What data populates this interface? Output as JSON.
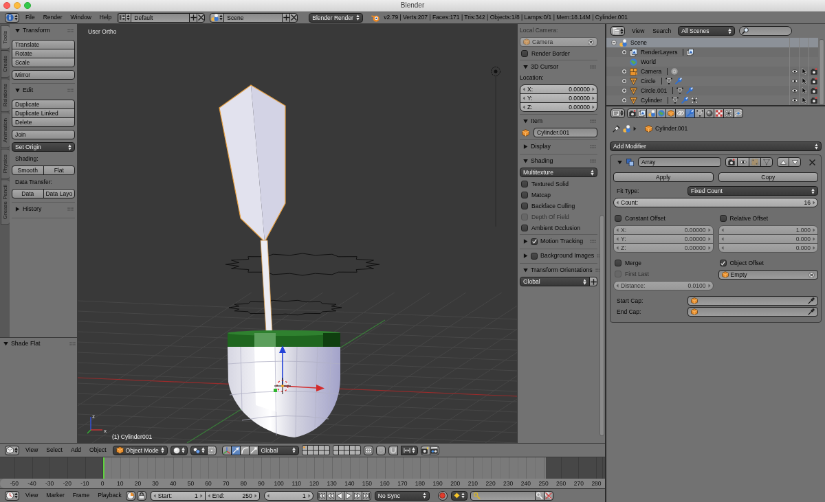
{
  "window": {
    "title": "Blender"
  },
  "info_header": {
    "menus": [
      "File",
      "Render",
      "Window",
      "Help"
    ],
    "layout": "Default",
    "scene": "Scene",
    "engine": "Blender Render",
    "stats": "v2.79 | Verts:207 | Faces:171 | Tris:342 | Objects:1/8 | Lamps:0/1 | Mem:18.14M | Cylinder.001"
  },
  "tool_tabs": [
    {
      "label": "Tools",
      "selected": true
    },
    {
      "label": "Create",
      "selected": false
    },
    {
      "label": "Relations",
      "selected": false
    },
    {
      "label": "Animation",
      "selected": false
    },
    {
      "label": "Physics",
      "selected": false
    },
    {
      "label": "Grease Pencil",
      "selected": false
    }
  ],
  "tool_panels": [
    {
      "title": "Transform",
      "expanded": true,
      "rows": [
        {
          "kind": "column",
          "buttons": [
            "Translate",
            "Rotate",
            "Scale"
          ]
        },
        {
          "kind": "column",
          "buttons": [
            "Mirror"
          ]
        }
      ]
    },
    {
      "title": "Edit",
      "expanded": true,
      "rows": [
        {
          "kind": "column",
          "buttons": [
            "Duplicate",
            "Duplicate Linked",
            "Delete"
          ]
        },
        {
          "kind": "column",
          "buttons": [
            "Join"
          ]
        },
        {
          "kind": "menu",
          "text": "Set Origin"
        },
        {
          "kind": "label",
          "text": "Shading:"
        },
        {
          "kind": "row",
          "buttons": [
            "Smooth",
            "Flat"
          ]
        },
        {
          "kind": "label",
          "text": "Data Transfer:"
        },
        {
          "kind": "row",
          "buttons": [
            "Data",
            "Data Layo"
          ]
        }
      ]
    },
    {
      "title": "History",
      "expanded": false
    }
  ],
  "operator_panel": {
    "title": "Shade Flat",
    "expanded": true
  },
  "viewport": {
    "view_label": "User Ortho",
    "object_label": "(1) Cylinder001",
    "axis_labels": [
      "z",
      "x"
    ]
  },
  "sidebar": [
    {
      "rows": [
        {
          "kind": "label",
          "text": "Local Camera:",
          "disabled": true
        },
        {
          "kind": "object_field",
          "text": "Camera",
          "disabled": true
        },
        {
          "kind": "checkbox",
          "label": "Render Border",
          "checked": false,
          "disabled": false
        }
      ]
    },
    {
      "title": "3D Cursor",
      "expanded": true,
      "rows": [
        {
          "kind": "label",
          "text": "Location:",
          "disabled": false
        },
        {
          "kind": "vector",
          "fields": [
            {
              "label": "X:",
              "value": "0.00000"
            },
            {
              "label": "Y:",
              "value": "0.00000"
            },
            {
              "label": "Z:",
              "value": "0.00000"
            }
          ]
        }
      ]
    },
    {
      "title": "Item",
      "expanded": true,
      "rows": [
        {
          "kind": "name_field",
          "text": "Cylinder.001"
        }
      ]
    },
    {
      "title": "Display",
      "expanded": false
    },
    {
      "title": "Shading",
      "expanded": true,
      "rows": [
        {
          "kind": "dropdown",
          "text": "Multitexture"
        },
        {
          "kind": "checkbox",
          "label": "Textured Solid",
          "checked": false,
          "disabled": false
        },
        {
          "kind": "checkbox",
          "label": "Matcap",
          "checked": false,
          "disabled": false
        },
        {
          "kind": "checkbox",
          "label": "Backface Culling",
          "checked": false,
          "disabled": false
        },
        {
          "kind": "checkbox",
          "label": "Depth Of Field",
          "checked": false,
          "disabled": true
        },
        {
          "kind": "checkbox",
          "label": "Ambient Occlusion",
          "checked": false,
          "disabled": false
        }
      ]
    },
    {
      "title": "Motion Tracking",
      "expanded": false,
      "checked": true
    },
    {
      "title": "Background Images",
      "expanded": false,
      "checked": false
    },
    {
      "title": "Transform Orientations",
      "expanded": true,
      "rows": [
        {
          "kind": "orientation",
          "text": "Global"
        }
      ]
    }
  ],
  "outliner": {
    "menus": [
      "View",
      "Search"
    ],
    "filter": "All Scenes",
    "tree": [
      {
        "label": "Scene",
        "kind": "scene",
        "expanded": true,
        "selected": true,
        "children": [
          {
            "label": "RenderLayers",
            "kind": "render_layers",
            "expanded": false,
            "selected": false,
            "data_icons": [
              {
                "kind": "render_layers"
              }
            ]
          },
          {
            "label": "World",
            "kind": "world",
            "selected": false
          },
          {
            "label": "Camera",
            "kind": "camera",
            "expanded": false,
            "selected": false,
            "data_icons": [
              {
                "kind": "camera_data"
              }
            ]
          },
          {
            "label": "Circle",
            "kind": "mesh",
            "expanded": false,
            "selected": false,
            "data_icons": [
              {
                "kind": "mesh_data"
              },
              {
                "kind": "modifier"
              }
            ]
          },
          {
            "label": "Circle.001",
            "kind": "mesh",
            "expanded": false,
            "selected": false,
            "data_icons": [
              {
                "kind": "mesh_data"
              },
              {
                "kind": "modifier"
              }
            ]
          },
          {
            "label": "Cylinder",
            "kind": "mesh",
            "expanded": false,
            "selected": false,
            "data_icons": [
              {
                "kind": "mesh_data"
              },
              {
                "kind": "modifier"
              },
              {
                "kind": "particles"
              }
            ]
          }
        ]
      }
    ]
  },
  "properties": {
    "tabs": [
      {
        "kind": "render",
        "selected": false
      },
      {
        "kind": "render_layers",
        "selected": false
      },
      {
        "kind": "scene",
        "selected": false
      },
      {
        "kind": "world",
        "selected": false
      },
      {
        "kind": "object",
        "selected": false
      },
      {
        "kind": "constraints",
        "selected": false
      },
      {
        "kind": "modifiers",
        "selected": true
      },
      {
        "kind": "data",
        "selected": false
      },
      {
        "kind": "material",
        "selected": false
      },
      {
        "kind": "texture",
        "selected": false
      },
      {
        "kind": "particles",
        "selected": false
      },
      {
        "kind": "physics",
        "selected": false
      }
    ],
    "context": "Cylinder.001",
    "add_modifier": "Add Modifier",
    "modifier": {
      "name": "Array",
      "expanded": true,
      "toggles": [
        {
          "kind": "render",
          "on": true
        },
        {
          "kind": "viewport",
          "on": true
        },
        {
          "kind": "editmode",
          "on": false
        },
        {
          "kind": "cage",
          "on": false
        }
      ],
      "apply": "Apply",
      "copy": "Copy",
      "fit_type_label": "Fit Type:",
      "fit_type": "Fixed Count",
      "count_label": "Count:",
      "count": "16",
      "constant_offset": {
        "label": "Constant Offset",
        "checked": false,
        "fields": [
          {
            "label": "X:",
            "value": "0.00000"
          },
          {
            "label": "Y:",
            "value": "0.00000"
          },
          {
            "label": "Z:",
            "value": "0.00000"
          }
        ]
      },
      "relative_offset": {
        "label": "Relative Offset",
        "checked": false,
        "fields": [
          {
            "value": "1.000"
          },
          {
            "value": "0.000"
          },
          {
            "value": "0.000"
          }
        ]
      },
      "merge": {
        "label": "Merge",
        "checked": false
      },
      "first_last": {
        "label": "First Last",
        "checked": false
      },
      "distance_label": "Distance:",
      "distance": "0.0100",
      "object_offset": {
        "label": "Object Offset",
        "checked": true,
        "object": "Empty"
      },
      "caps": [
        {
          "label": "Start Cap:"
        },
        {
          "label": "End Cap:"
        }
      ]
    }
  },
  "view3d_header": {
    "menus": [
      "View",
      "Select",
      "Add",
      "Object"
    ],
    "mode": "Object Mode",
    "manipulators": [
      {
        "kind": "axes",
        "selected": false
      },
      {
        "kind": "translate",
        "selected": true
      },
      {
        "kind": "rotate",
        "selected": false
      },
      {
        "kind": "scale",
        "selected": false
      }
    ],
    "orientation": "Global",
    "layers": [
      {
        "active_object": true
      },
      {
        "active_object": false
      },
      {
        "active_object": false
      },
      {
        "active_object": false
      },
      {
        "active_object": false
      },
      {
        "active_object": false
      },
      {
        "active_object": false
      },
      {
        "active_object": false
      },
      {
        "active_object": false
      },
      {
        "active_object": false
      },
      {
        "active_object": false
      },
      {
        "active_object": false
      },
      {
        "active_object": false
      },
      {
        "active_object": false
      },
      {
        "active_object": false
      },
      {
        "active_object": false
      },
      {
        "active_object": false
      },
      {
        "active_object": false
      },
      {
        "active_object": false
      },
      {
        "active_object": false
      }
    ]
  },
  "timeline": {
    "ruler": [
      "-50",
      "-40",
      "-30",
      "-20",
      "-10",
      "0",
      "10",
      "20",
      "30",
      "40",
      "50",
      "60",
      "70",
      "80",
      "90",
      "100",
      "110",
      "120",
      "130",
      "140",
      "150",
      "160",
      "170",
      "180",
      "190",
      "200",
      "210",
      "220",
      "230",
      "240",
      "250",
      "260",
      "270",
      "280"
    ],
    "menus": [
      "View",
      "Marker",
      "Frame",
      "Playback"
    ],
    "start_label": "Start:",
    "start": "1",
    "end_label": "End:",
    "end": "250",
    "frame": "1",
    "sync": "No Sync"
  }
}
